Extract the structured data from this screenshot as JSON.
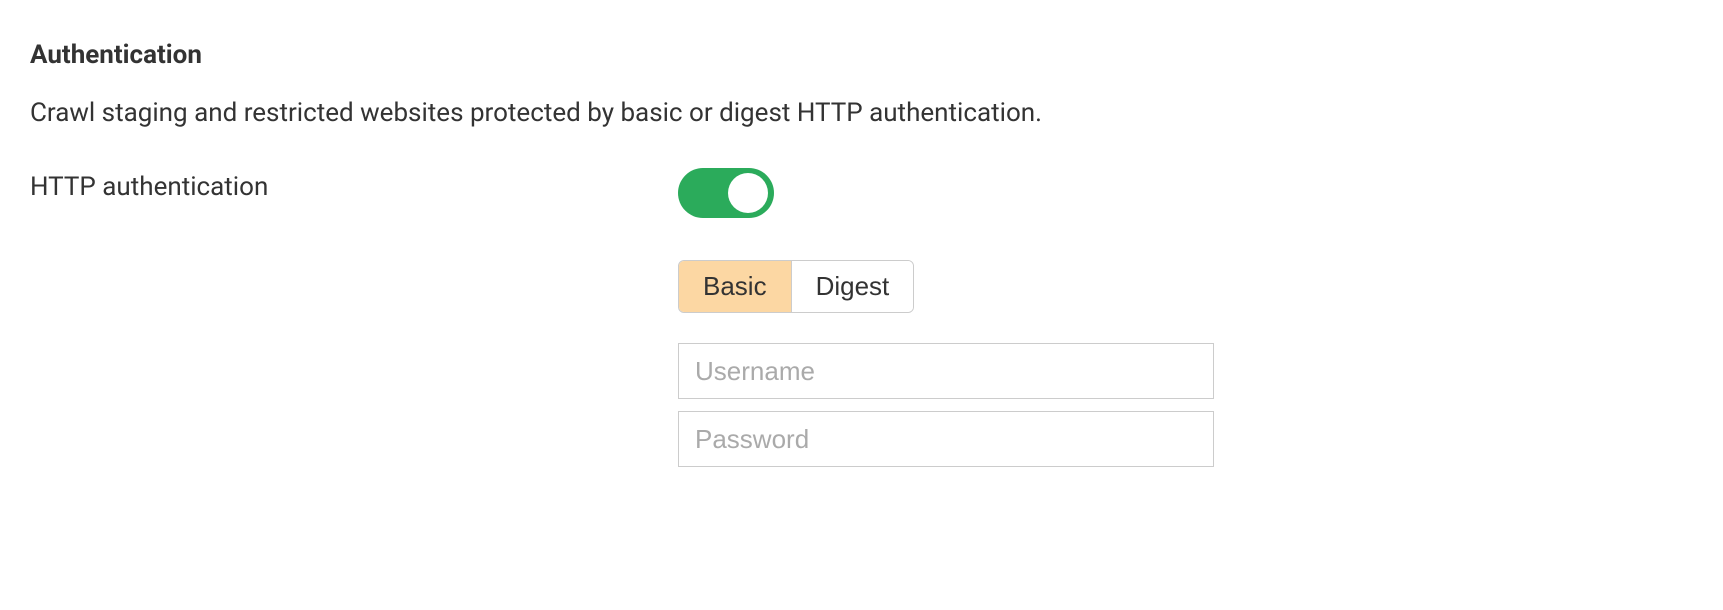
{
  "section": {
    "title": "Authentication",
    "description": "Crawl staging and restricted websites protected by basic or digest HTTP authentication."
  },
  "form": {
    "http_auth_label": "HTTP authentication",
    "toggle_on": true,
    "auth_type": {
      "options": [
        "Basic",
        "Digest"
      ],
      "selected": "Basic"
    },
    "username": {
      "placeholder": "Username",
      "value": ""
    },
    "password": {
      "placeholder": "Password",
      "value": ""
    }
  }
}
